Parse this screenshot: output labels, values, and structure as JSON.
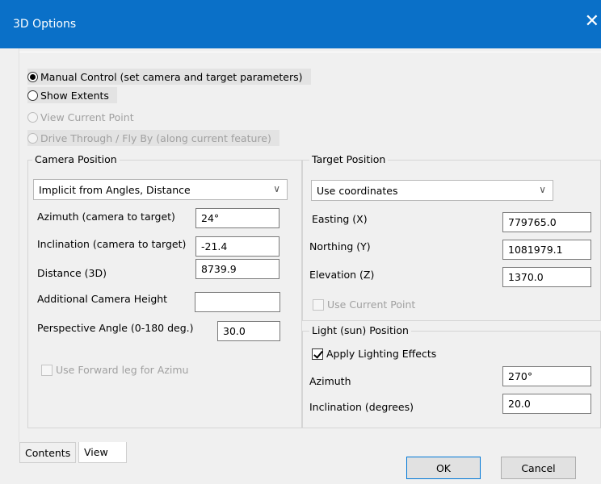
{
  "window": {
    "title": "3D Options",
    "close_glyph": "✕"
  },
  "mode": {
    "options": [
      {
        "label": "Manual Control (set camera and target parameters)",
        "checked": true,
        "disabled": false
      },
      {
        "label": "Show Extents",
        "checked": false,
        "disabled": false
      },
      {
        "label": "View Current Point",
        "checked": false,
        "disabled": true
      },
      {
        "label": "Drive Through / Fly By (along current feature)",
        "checked": false,
        "disabled": true
      }
    ]
  },
  "camera": {
    "group_label": "Camera Position",
    "method": {
      "selected": "Implicit from Angles, Distance"
    },
    "azimuth": {
      "label": "Azimuth (camera to target)",
      "value": "24°"
    },
    "inclination": {
      "label": "Inclination (camera to target)",
      "value": "-21.4"
    },
    "distance": {
      "label": "Distance (3D)",
      "value": "8739.9"
    },
    "additional_height": {
      "label": "Additional Camera Height",
      "value": ""
    },
    "perspective": {
      "label": "Perspective Angle (0-180 deg.)",
      "value": "30.0"
    },
    "forward_leg": {
      "label": "Use Forward leg for Azimu",
      "checked": false,
      "disabled": true
    }
  },
  "target": {
    "group_label": "Target Position",
    "method": {
      "selected": "Use coordinates"
    },
    "easting": {
      "label": "Easting (X)",
      "value": "779765.0"
    },
    "northing": {
      "label": "Northing (Y)",
      "value": "1081979.1"
    },
    "elevation": {
      "label": "Elevation (Z)",
      "value": "1370.0"
    },
    "use_current_point": {
      "label": "Use Current Point",
      "checked": false,
      "disabled": true
    }
  },
  "light": {
    "group_label": "Light (sun) Position",
    "apply": {
      "label": "Apply Lighting Effects",
      "checked": true
    },
    "azimuth": {
      "label": "Azimuth",
      "value": "270°"
    },
    "inclination": {
      "label": "Inclination (degrees)",
      "value": "20.0"
    }
  },
  "tabs": [
    {
      "label": "Contents",
      "active": false
    },
    {
      "label": "View",
      "active": true
    }
  ],
  "buttons": {
    "ok": "OK",
    "cancel": "Cancel"
  },
  "icons": {
    "dropdown": "chevron-down-icon",
    "close": "close-icon"
  },
  "colors": {
    "titlebar": "#0a70c8",
    "default_button_border": "#0078d7"
  }
}
